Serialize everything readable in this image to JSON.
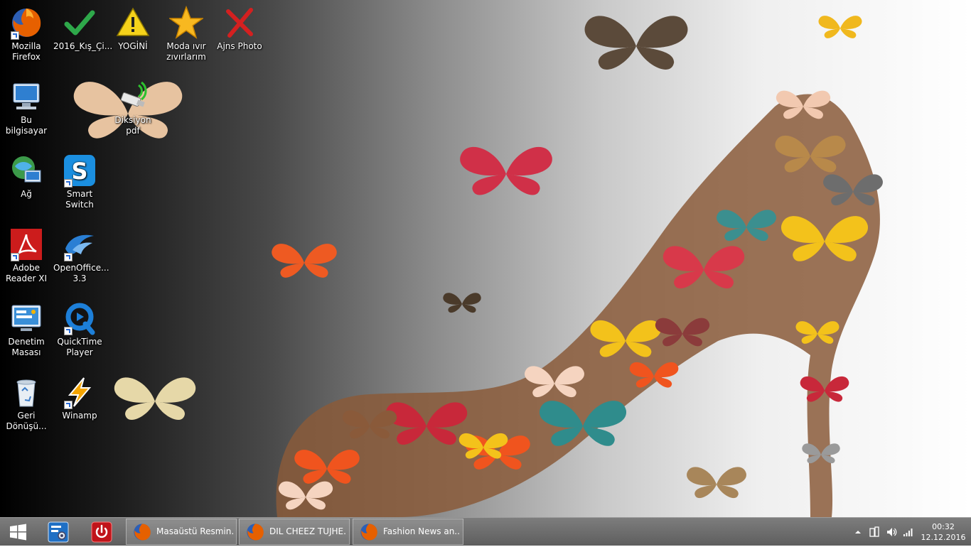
{
  "desktop_icons": {
    "firefox": {
      "label": "Mozilla Firefox"
    },
    "kis": {
      "label": "2016_Kış_Çi..."
    },
    "yogini": {
      "label": "YOGİNİ"
    },
    "moda": {
      "label": "Moda ıvır zıvırlarım"
    },
    "ajns": {
      "label": "Ajns Photo"
    },
    "bilgisayar": {
      "label": "Bu bilgisayar"
    },
    "diksiyon": {
      "label": "Diksiyon pdf"
    },
    "ag": {
      "label": "Ağ"
    },
    "smart_switch": {
      "label": "Smart Switch"
    },
    "adobe": {
      "label": "Adobe Reader XI"
    },
    "openoffice": {
      "label": "OpenOffice... 3.3"
    },
    "denetim": {
      "label": "Denetim Masası"
    },
    "quicktime": {
      "label": "QuickTime Player"
    },
    "geri": {
      "label": "Geri Dönüşü..."
    },
    "winamp": {
      "label": "Winamp"
    }
  },
  "taskbar": {
    "windows": [
      {
        "label": "Masaüstü Resmin..."
      },
      {
        "label": "DIL CHEEZ TUJHE..."
      },
      {
        "label": "Fashion News an..."
      }
    ],
    "clock": {
      "time": "00:32",
      "date": "12.12.2016"
    }
  },
  "colors": {
    "taskbar": "#6a6a6a",
    "firefox_orange": "#e66000",
    "power_red": "#c0141a"
  }
}
